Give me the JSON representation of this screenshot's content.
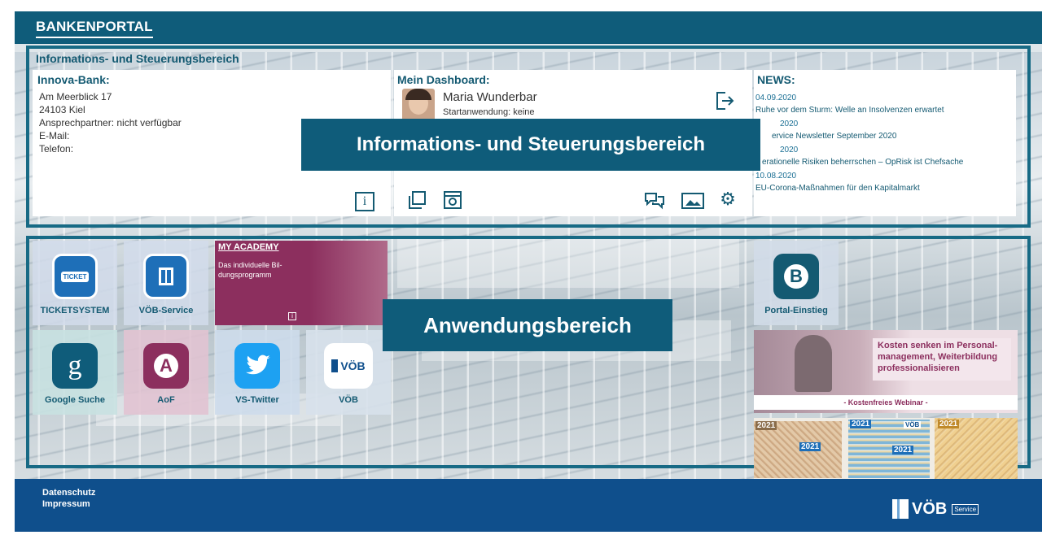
{
  "header": {
    "brand": "BANKENPORTAL"
  },
  "info_section": {
    "title": "Informations- und Steuerungsbereich"
  },
  "bank": {
    "title": "Innova-Bank:",
    "street": "Am Meerblick 17",
    "city": "24103 Kiel",
    "contact": "Ansprechpartner: nicht verfügbar",
    "email": "E-Mail:",
    "phone": "Telefon:"
  },
  "dashboard": {
    "title": "Mein Dashboard:",
    "user_name": "Maria Wunderbar",
    "start_app": "Startanwendung: keine"
  },
  "news": {
    "title": "NEWS:",
    "items": [
      {
        "date": "04.09.2020",
        "text": "Ruhe vor dem Sturm: Welle an Insolvenzen erwartet"
      },
      {
        "date": "2020",
        "text": "ervice Newsletter September 2020"
      },
      {
        "date": "2020",
        "text": "erationelle Risiken beherrschen – OpRisk ist Chefsache"
      },
      {
        "date": "10.08.2020",
        "text": "EU-Corona-Maßnahmen für den Kapitalmarkt"
      }
    ]
  },
  "overlays": {
    "info": "Informations- und Steuerungsbereich",
    "apps": "Anwendungsbereich"
  },
  "academy": {
    "title": "MY ACADEMY",
    "text": "Das individuelle Bil-dungsprogramm"
  },
  "tiles": [
    {
      "label": "TICKETSYSTEM",
      "icon": "ticket-icon",
      "badge": "TICKET"
    },
    {
      "label": "VÖB-Service",
      "icon": "voeb-service-icon"
    },
    {
      "label": "Google Suche",
      "icon": "google-icon",
      "glyph": "g"
    },
    {
      "label": "AoF",
      "icon": "aof-icon",
      "glyph": "A"
    },
    {
      "label": "VS-Twitter",
      "icon": "twitter-icon"
    },
    {
      "label": "VÖB",
      "icon": "voeb-icon",
      "glyph": "VÖB"
    },
    {
      "label": "Portal-Einstieg",
      "icon": "portal-icon",
      "glyph": "B"
    }
  ],
  "webinar": {
    "headline": "Kosten senken im Personal-management, Weiterbildung professionalisieren",
    "sub": "- Kostenfreies Webinar -"
  },
  "calendar": {
    "years": [
      "2021",
      "2021",
      "2021",
      "2021",
      "2021"
    ],
    "brand": "VÖB"
  },
  "footer": {
    "privacy": "Datenschutz",
    "imprint": "Impressum",
    "logo_text": "VÖB",
    "logo_sub": "Service"
  },
  "colors": {
    "primary": "#0f5c7a",
    "footer": "#0f4f8c",
    "academy": "#8c2f5e"
  }
}
